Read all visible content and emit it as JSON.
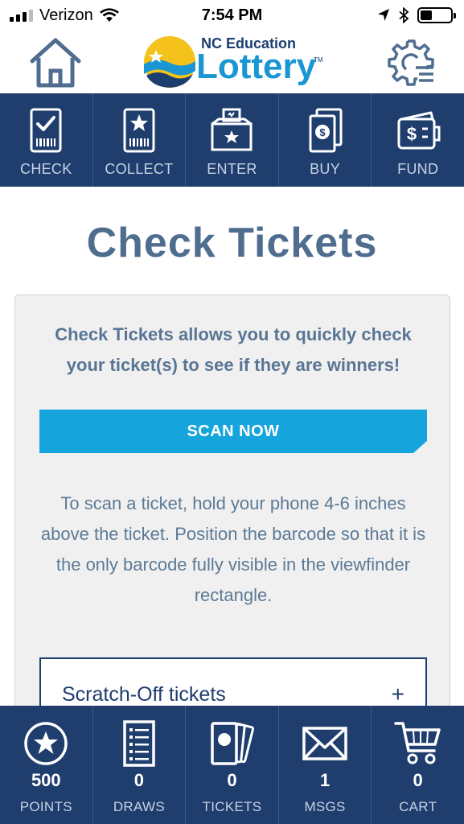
{
  "status_bar": {
    "carrier": "Verizon",
    "time": "7:54 PM"
  },
  "header": {
    "logo_small": "NC Education",
    "logo_big": "Lottery",
    "logo_tm": "TM"
  },
  "topnav": {
    "items": [
      {
        "label": "CHECK",
        "icon": "check-ticket-icon"
      },
      {
        "label": "COLLECT",
        "icon": "collect-ticket-icon"
      },
      {
        "label": "ENTER",
        "icon": "ballot-box-icon"
      },
      {
        "label": "BUY",
        "icon": "buy-ticket-icon"
      },
      {
        "label": "FUND",
        "icon": "wallet-icon"
      }
    ]
  },
  "main": {
    "title": "Check Tickets",
    "intro": "Check Tickets allows you to quickly check your ticket(s) to see if they are winners!",
    "scan_button": "SCAN NOW",
    "instructions": "To scan a ticket, hold your phone 4-6 inches above the ticket. Position the barcode so that it is the only barcode fully visible in the viewfinder rectangle.",
    "accordion": {
      "title": "Scratch-Off tickets",
      "toggle": "+"
    }
  },
  "bottomnav": {
    "items": [
      {
        "count": "500",
        "label": "POINTS",
        "icon": "star-badge-icon"
      },
      {
        "count": "0",
        "label": "DRAWS",
        "icon": "draw-slip-icon"
      },
      {
        "count": "0",
        "label": "TICKETS",
        "icon": "tickets-icon"
      },
      {
        "count": "1",
        "label": "MSGS",
        "icon": "envelope-icon"
      },
      {
        "count": "0",
        "label": "CART",
        "icon": "cart-icon"
      }
    ]
  },
  "colors": {
    "navy": "#1f3e6e",
    "accent_blue": "#16a4dd",
    "title_slate": "#4f6e8f"
  }
}
